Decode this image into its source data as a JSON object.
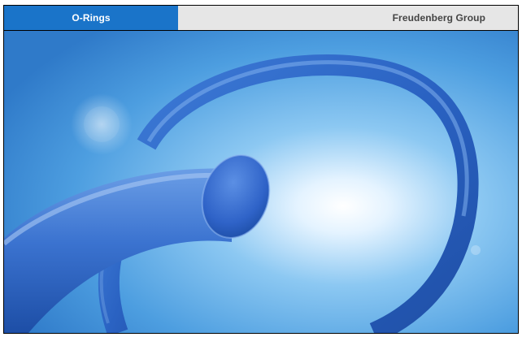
{
  "tabs": [
    {
      "label": "O-Rings",
      "active": true
    },
    {
      "label": "Freudenberg Group",
      "active": false
    }
  ],
  "hero": {
    "subject": "blue o-ring image",
    "colors": {
      "accent": "#1a74c9",
      "tab_inactive_bg": "#e6e6e6",
      "sky_light": "#eaf6ff",
      "sky_dark": "#2a78c8",
      "ring_blue": "#2f69c9"
    }
  }
}
